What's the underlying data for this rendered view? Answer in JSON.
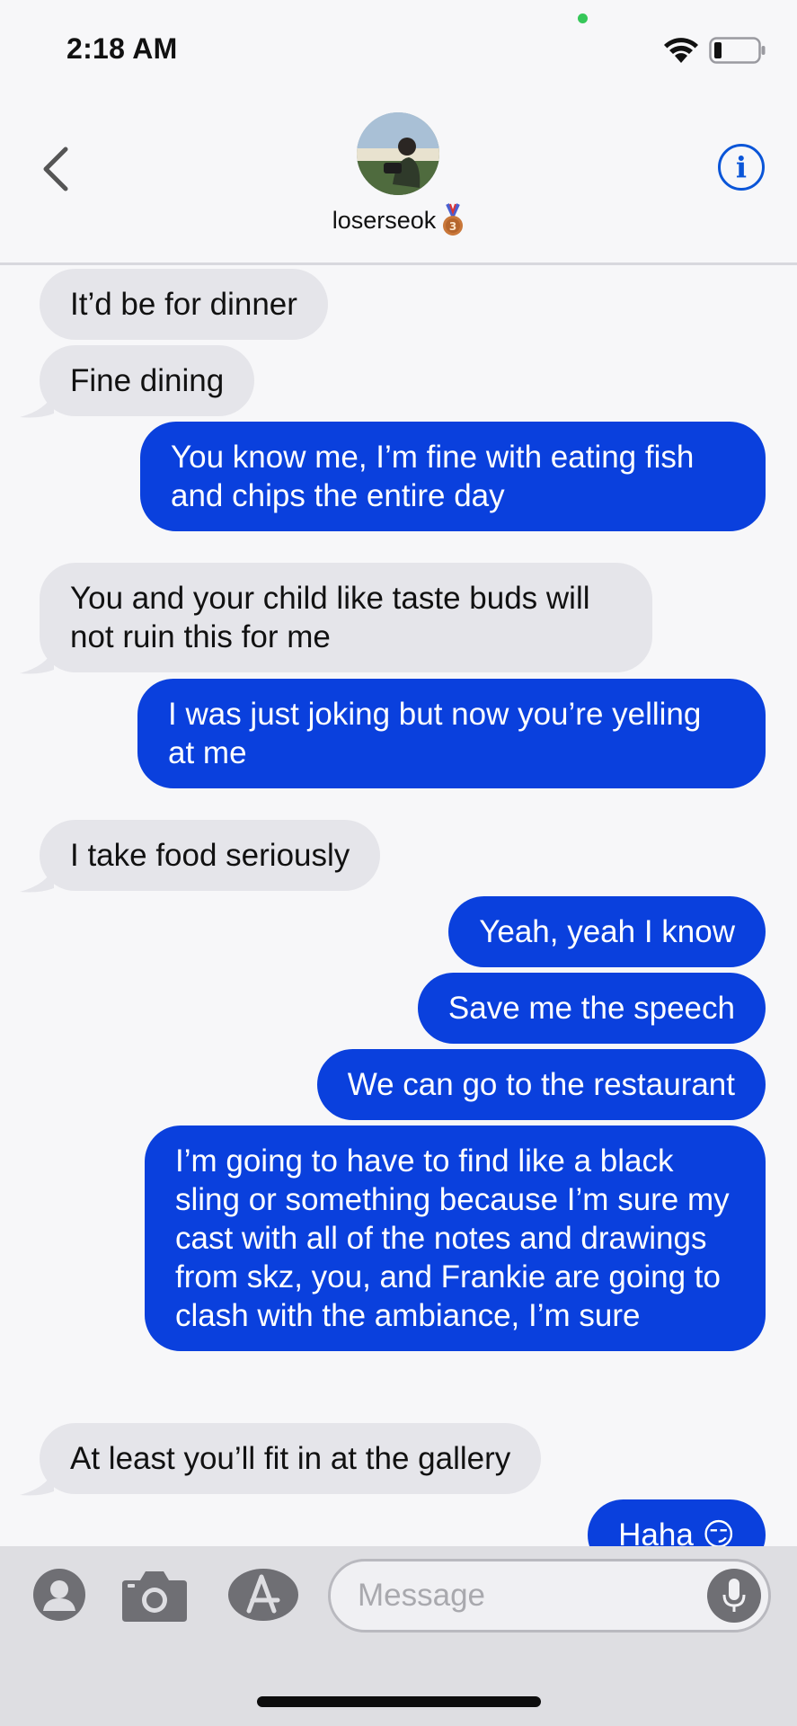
{
  "status_bar": {
    "time": "2:18 AM"
  },
  "header": {
    "contact_name": "loserseok",
    "back_icon": "chevron-left-icon",
    "info_icon": "info-icon",
    "info_glyph": "i",
    "badge_icon": "bronze-medal-icon"
  },
  "messages": [
    {
      "side": "in",
      "text": "It’d be for dinner"
    },
    {
      "side": "in",
      "text": "Fine dining"
    },
    {
      "side": "out",
      "text": "You know me, I’m fine with eating fish and chips the entire day"
    },
    {
      "side": "in",
      "text": "You and your child like taste buds will not ruin this for me"
    },
    {
      "side": "out",
      "text": "I was just joking but now you’re yelling at me"
    },
    {
      "side": "in",
      "text": "I take food seriously"
    },
    {
      "side": "out",
      "text": "Yeah, yeah I know"
    },
    {
      "side": "out",
      "text": "Save me the speech"
    },
    {
      "side": "out",
      "text": "We can go to the restaurant"
    },
    {
      "side": "out",
      "text": "I’m going to have to find like a black sling or something because I’m sure my cast with all of the notes and drawings from skz, you, and Frankie are going to clash with the ambiance, I’m sure"
    },
    {
      "side": "in",
      "text": "At least you’ll fit in at the gallery"
    },
    {
      "side": "out",
      "text": "Haha 😏"
    }
  ],
  "composer": {
    "placeholder": "Message",
    "icons": [
      "contacts-icon",
      "camera-icon",
      "app-store-icon",
      "microphone-icon"
    ]
  },
  "colors": {
    "outgoing_bubble": "#0a40dd",
    "incoming_bubble": "#e5e5ea",
    "accent": "#0a55d8"
  }
}
